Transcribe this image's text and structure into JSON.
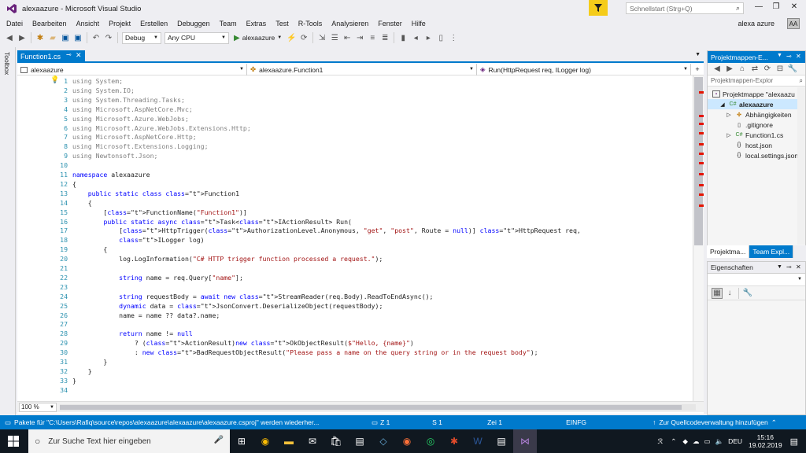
{
  "window": {
    "title": "alexaazure - Microsoft Visual Studio",
    "quicklaunch_placeholder": "Schnellstart (Strg+Q)"
  },
  "menu": [
    "Datei",
    "Bearbeiten",
    "Ansicht",
    "Projekt",
    "Erstellen",
    "Debuggen",
    "Team",
    "Extras",
    "Test",
    "R-Tools",
    "Analysieren",
    "Fenster",
    "Hilfe"
  ],
  "user": {
    "name": "alexa azure",
    "initials": "AA"
  },
  "toolbar": {
    "config": "Debug",
    "platform": "Any CPU",
    "start_label": "alexaazure"
  },
  "sidebar_left": {
    "toolbox_label": "Toolbox"
  },
  "editor": {
    "tab_label": "Function1.cs",
    "nav": {
      "project": "alexaazure",
      "class": "alexaazure.Function1",
      "member": "Run(HttpRequest req, ILogger log)"
    },
    "zoom": "100 %",
    "lines": [
      {
        "n": "1",
        "code": "using System;"
      },
      {
        "n": "2",
        "code": "using System.IO;"
      },
      {
        "n": "3",
        "code": "using System.Threading.Tasks;"
      },
      {
        "n": "4",
        "code": "using Microsoft.AspNetCore.Mvc;"
      },
      {
        "n": "5",
        "code": "using Microsoft.Azure.WebJobs;"
      },
      {
        "n": "6",
        "code": "using Microsoft.Azure.WebJobs.Extensions.Http;"
      },
      {
        "n": "7",
        "code": "using Microsoft.AspNetCore.Http;"
      },
      {
        "n": "8",
        "code": "using Microsoft.Extensions.Logging;"
      },
      {
        "n": "9",
        "code": "using Newtonsoft.Json;"
      },
      {
        "n": "10",
        "code": ""
      },
      {
        "n": "11",
        "code": "namespace alexaazure"
      },
      {
        "n": "12",
        "code": "{"
      },
      {
        "n": "13",
        "code": "    public static class Function1"
      },
      {
        "n": "14",
        "code": "    {"
      },
      {
        "n": "15",
        "code": "        [FunctionName(\"Function1\")]"
      },
      {
        "n": "16",
        "code": "        public static async Task<IActionResult> Run("
      },
      {
        "n": "17",
        "code": "            [HttpTrigger(AuthorizationLevel.Anonymous, \"get\", \"post\", Route = null)] HttpRequest req,"
      },
      {
        "n": "18",
        "code": "            ILogger log)"
      },
      {
        "n": "19",
        "code": "        {"
      },
      {
        "n": "20",
        "code": "            log.LogInformation(\"C# HTTP trigger function processed a request.\");"
      },
      {
        "n": "21",
        "code": ""
      },
      {
        "n": "22",
        "code": "            string name = req.Query[\"name\"];"
      },
      {
        "n": "23",
        "code": ""
      },
      {
        "n": "24",
        "code": "            string requestBody = await new StreamReader(req.Body).ReadToEndAsync();"
      },
      {
        "n": "25",
        "code": "            dynamic data = JsonConvert.DeserializeObject(requestBody);"
      },
      {
        "n": "26",
        "code": "            name = name ?? data?.name;"
      },
      {
        "n": "27",
        "code": ""
      },
      {
        "n": "28",
        "code": "            return name != null"
      },
      {
        "n": "29",
        "code": "                ? (ActionResult)new OkObjectResult($\"Hello, {name}\")"
      },
      {
        "n": "30",
        "code": "                : new BadRequestObjectResult(\"Please pass a name on the query string or in the request body\");"
      },
      {
        "n": "31",
        "code": "        }"
      },
      {
        "n": "32",
        "code": "    }"
      },
      {
        "n": "33",
        "code": "}"
      },
      {
        "n": "34",
        "code": ""
      }
    ]
  },
  "solution_explorer": {
    "title": "Projektmappen-E...",
    "search_placeholder": "Projektmappen-Explor",
    "items": [
      {
        "label": "Projektmappe \"alexaazu"
      },
      {
        "label": "alexaazure"
      },
      {
        "label": "Abhängigkeiten"
      },
      {
        "label": ".gitignore"
      },
      {
        "label": "Function1.cs"
      },
      {
        "label": "host.json"
      },
      {
        "label": "local.settings.json"
      }
    ],
    "tabs": [
      "Projektma...",
      "Team Expl..."
    ]
  },
  "properties": {
    "title": "Eigenschaften"
  },
  "status": {
    "message": "Pakete für \"C:\\Users\\Rafiq\\source\\repos\\alexaazure\\alexaazure\\alexaazure.csproj\" werden wiederher...",
    "z": "Z 1",
    "s": "S 1",
    "zei": "Zei 1",
    "mode": "EINFG",
    "scc": "Zur Quellcodeverwaltung hinzufügen"
  },
  "taskbar": {
    "search_placeholder": "Zur Suche Text hier eingeben",
    "lang": "DEU",
    "time": "15:16",
    "date": "19.02.2019"
  },
  "colors": {
    "accent": "#007acc",
    "keyword": "#0000ff",
    "type": "#2b91af",
    "string": "#a31515"
  }
}
